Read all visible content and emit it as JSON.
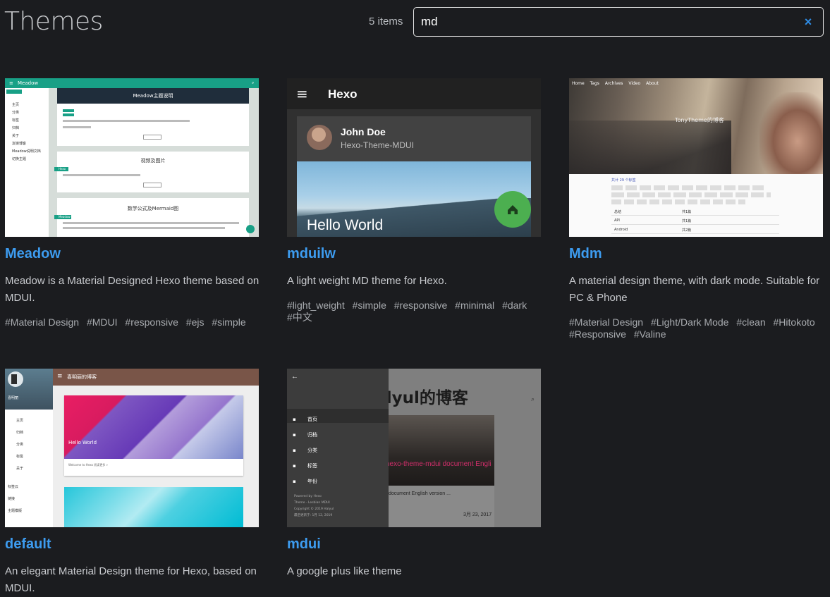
{
  "header": {
    "title": "Themes",
    "count": "5 items",
    "search_value": "md",
    "clear_icon": "×"
  },
  "cards": [
    {
      "name": "Meadow",
      "description": "Meadow is a Material Designed Hexo theme based on MDUI.",
      "tags": [
        "#Material Design",
        "#MDUI",
        "#responsive",
        "#ejs",
        "#simple"
      ],
      "thumb": {
        "brand": "Meadow",
        "post1": "Meadow主题说明",
        "post2": "视频及图片",
        "post3": "数学公式及Mermaid图",
        "tag1": "Hexo",
        "tag2": "Meadow",
        "button": "阅读更多",
        "nav": [
          "主页",
          "分类",
          "标签",
          "归档",
          "关于",
          "友链博客",
          "Meadow说明文档",
          "切换主题"
        ],
        "accent": "#18a086"
      }
    },
    {
      "name": "mduilw",
      "description": "A light weight MD theme for Hexo.",
      "tags": [
        "#light_weight",
        "#simple",
        "#responsive",
        "#minimal",
        "#dark",
        "#中文"
      ],
      "thumb": {
        "brand": "Hexo",
        "author": "John Doe",
        "subtitle": "Hexo-Theme-MDUI",
        "post": "Hello World",
        "fab_icon": "home-icon",
        "fab_color": "#4caf50"
      }
    },
    {
      "name": "Mdm",
      "description": "A material design theme, with dark mode. Suitable for PC & Phone",
      "tags": [
        "#Material Design",
        "#Light/Dark Mode",
        "#clean",
        "#Hitokoto",
        "#Responsive",
        "#Valine"
      ],
      "thumb": {
        "nav": [
          "Home",
          "Tags",
          "Archives",
          "Video",
          "About"
        ],
        "hero": "TonyTheme的博客",
        "section": "共计 29 个标签",
        "rows": [
          "总结",
          "API",
          "Android"
        ],
        "row_values": [
          "共1篇",
          "共1篇",
          "共2篇"
        ]
      }
    },
    {
      "name": "default",
      "description": "An elegant Material Design theme for Hexo, based on MDUI.",
      "tags": [],
      "thumb": {
        "blog": "喜明丽的博客",
        "user": "喜明丽",
        "post": "Hello World",
        "excerpt": "Welcome to Hexo 阅读更多 »",
        "nav": [
          "主页",
          "归档",
          "分类",
          "标签",
          "关于"
        ],
        "extra": [
          "标签云",
          "链接",
          "主题模版"
        ]
      }
    },
    {
      "name": "mdui",
      "description": "A google plus like theme",
      "tags": [],
      "thumb": {
        "title": "Halyul的博客",
        "menu": [
          "首页",
          "归档",
          "分类",
          "标签",
          "年份"
        ],
        "post": "hexo-theme-mdui document English",
        "excerpt": "document English version ...",
        "date": "3月 23, 2017",
        "footer": [
          "Powered by Hexo",
          "Theme - Lesbian MDUI",
          "Copyright © 2019 Halyul",
          "最后更新于: 1月 12, 2019"
        ]
      }
    }
  ]
}
